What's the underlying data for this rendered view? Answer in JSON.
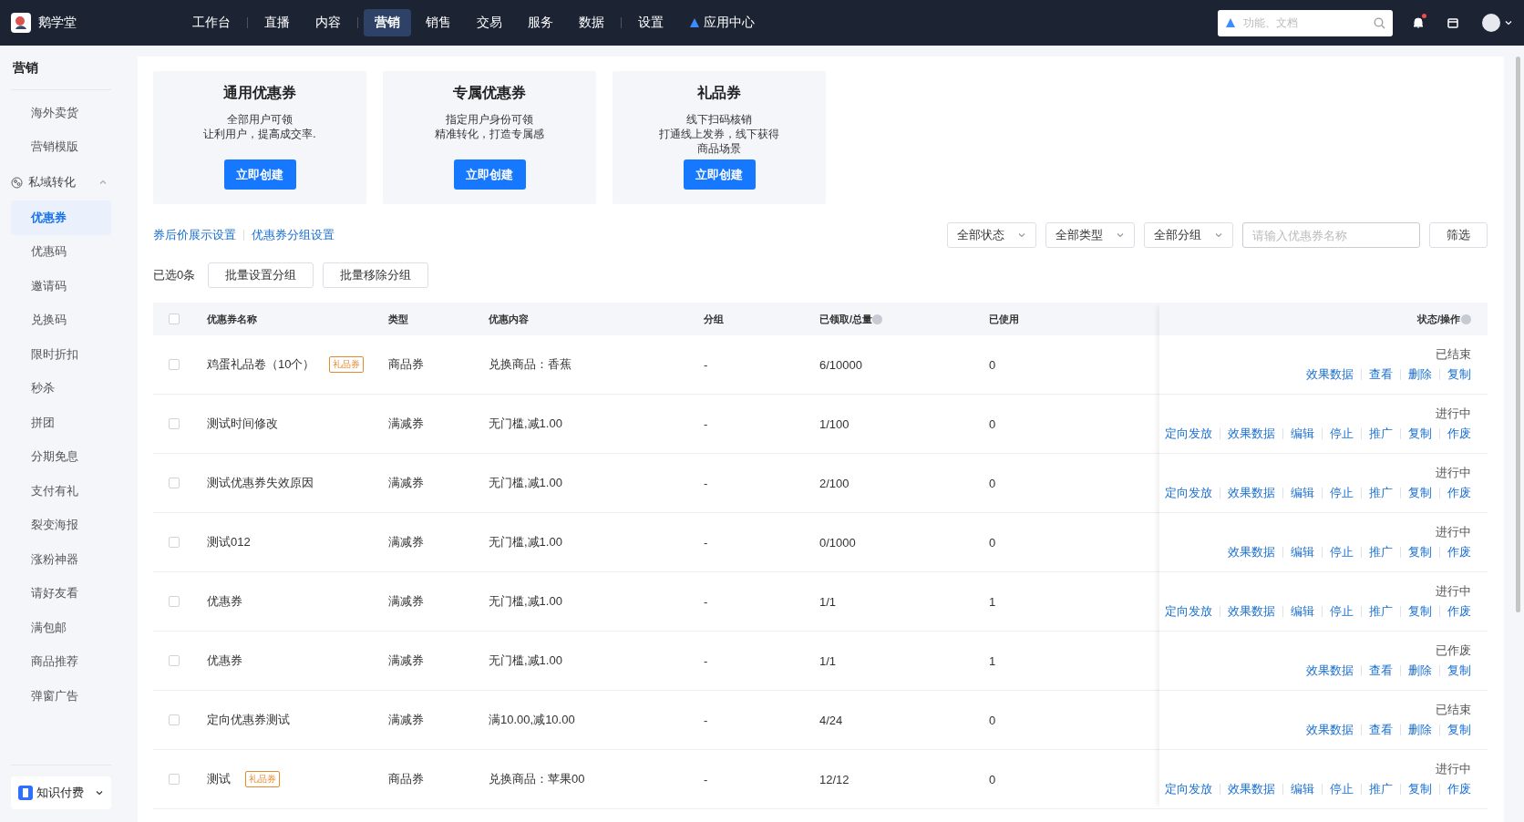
{
  "topbar": {
    "brand": "鹅学堂",
    "nav_groups": [
      [
        {
          "label": "工作台",
          "selected": false,
          "kind": "plain"
        }
      ],
      [
        {
          "label": "直播",
          "selected": false,
          "kind": "plain"
        },
        {
          "label": "内容",
          "selected": false,
          "kind": "plain"
        }
      ],
      [
        {
          "label": "营销",
          "selected": true,
          "kind": "plain"
        },
        {
          "label": "销售",
          "selected": false,
          "kind": "plain"
        },
        {
          "label": "交易",
          "selected": false,
          "kind": "plain"
        },
        {
          "label": "服务",
          "selected": false,
          "kind": "plain"
        },
        {
          "label": "数据",
          "selected": false,
          "kind": "plain"
        }
      ],
      [
        {
          "label": "设置",
          "selected": false,
          "kind": "plain"
        },
        {
          "label": "应用中心",
          "selected": false,
          "kind": "app"
        }
      ]
    ],
    "search": {
      "placeholder": "功能、文档"
    },
    "notification_dot": true
  },
  "sidebar": {
    "title": "营销",
    "items": [
      {
        "label": "海外卖货",
        "selected": false
      },
      {
        "label": "营销模版",
        "selected": false
      },
      {
        "label": "私域转化",
        "expanded": true,
        "children": [
          {
            "label": "优惠券",
            "selected": true
          },
          {
            "label": "优惠码",
            "selected": false
          },
          {
            "label": "邀请码",
            "selected": false
          },
          {
            "label": "兑换码",
            "selected": false
          },
          {
            "label": "限时折扣",
            "selected": false
          },
          {
            "label": "秒杀",
            "selected": false
          },
          {
            "label": "拼团",
            "selected": false
          },
          {
            "label": "分期免息",
            "selected": false
          },
          {
            "label": "支付有礼",
            "selected": false
          },
          {
            "label": "裂变海报",
            "selected": false
          },
          {
            "label": "涨粉神器",
            "selected": false
          },
          {
            "label": "请好友看",
            "selected": false
          },
          {
            "label": "满包邮",
            "selected": false
          },
          {
            "label": "商品推荐",
            "selected": false
          },
          {
            "label": "弹窗广告",
            "selected": false
          }
        ]
      }
    ],
    "footer": "知识付费"
  },
  "cards": [
    {
      "title": "通用优惠券",
      "lines": [
        "全部用户可领",
        "让利用户，提高成交率."
      ],
      "button": "立即创建"
    },
    {
      "title": "专属优惠券",
      "lines": [
        "指定用户身份可领",
        "精准转化，打造专属感"
      ],
      "button": "立即创建"
    },
    {
      "title": "礼品券",
      "lines": [
        "线下扫码核销",
        "打通线上发券，线下获得",
        "商品场景"
      ],
      "button": "立即创建"
    }
  ],
  "links": [
    "券后价展示设置",
    "优惠券分组设置"
  ],
  "filters": {
    "selects": [
      "全部状态",
      "全部类型",
      "全部分组"
    ],
    "search_placeholder": "请输入优惠券名称",
    "button": "筛选"
  },
  "selection": {
    "count": "已选0条",
    "buttons": [
      "批量设置分组",
      "批量移除分组"
    ]
  },
  "table": {
    "columns": [
      "优惠券名称",
      "类型",
      "优惠内容",
      "分组",
      "已领取/总量",
      "已使用",
      "状态/操作"
    ],
    "all_checked": false,
    "rows": [
      {
        "checked": false,
        "name": "鸡蛋礼品卷（10个）",
        "tag": "礼品券",
        "type": "商品券",
        "content": "兑换商品：香蕉",
        "group": "-",
        "claimed": "6/10000",
        "used": "0",
        "status": "已结束",
        "actions": [
          "效果数据",
          "查看",
          "删除",
          "复制"
        ]
      },
      {
        "checked": false,
        "name": "测试时间修改",
        "type": "满减券",
        "content": "无门槛,减1.00",
        "group": "-",
        "claimed": "1/100",
        "used": "0",
        "status": "进行中",
        "actions": [
          "定向发放",
          "效果数据",
          "编辑",
          "停止",
          "推广",
          "复制",
          "作废"
        ]
      },
      {
        "checked": false,
        "name": "测试优惠券失效原因",
        "type": "满减券",
        "content": "无门槛,减1.00",
        "group": "-",
        "claimed": "2/100",
        "used": "0",
        "status": "进行中",
        "actions": [
          "定向发放",
          "效果数据",
          "编辑",
          "停止",
          "推广",
          "复制",
          "作废"
        ]
      },
      {
        "checked": false,
        "name": "测试012",
        "type": "满减券",
        "content": "无门槛,减1.00",
        "group": "-",
        "claimed": "0/1000",
        "used": "0",
        "status": "进行中",
        "actions": [
          "效果数据",
          "编辑",
          "停止",
          "推广",
          "复制",
          "作废"
        ]
      },
      {
        "checked": false,
        "name": "优惠券",
        "type": "满减券",
        "content": "无门槛,减1.00",
        "group": "-",
        "claimed": "1/1",
        "used": "1",
        "status": "进行中",
        "actions": [
          "定向发放",
          "效果数据",
          "编辑",
          "停止",
          "推广",
          "复制",
          "作废"
        ]
      },
      {
        "checked": false,
        "name": "优惠券",
        "type": "满减券",
        "content": "无门槛,减1.00",
        "group": "-",
        "claimed": "1/1",
        "used": "1",
        "status": "已作废",
        "actions": [
          "效果数据",
          "查看",
          "删除",
          "复制"
        ]
      },
      {
        "checked": false,
        "name": "定向优惠券测试",
        "type": "满减券",
        "content": "满10.00,减10.00",
        "group": "-",
        "claimed": "4/24",
        "used": "0",
        "status": "已结束",
        "actions": [
          "效果数据",
          "查看",
          "删除",
          "复制"
        ]
      },
      {
        "checked": false,
        "name": "测试",
        "tag": "礼品券",
        "type": "商品券",
        "content": "兑换商品：苹果00",
        "group": "-",
        "claimed": "12/12",
        "used": "0",
        "status": "进行中",
        "actions": [
          "定向发放",
          "效果数据",
          "编辑",
          "停止",
          "推广",
          "复制",
          "作废"
        ]
      }
    ]
  }
}
